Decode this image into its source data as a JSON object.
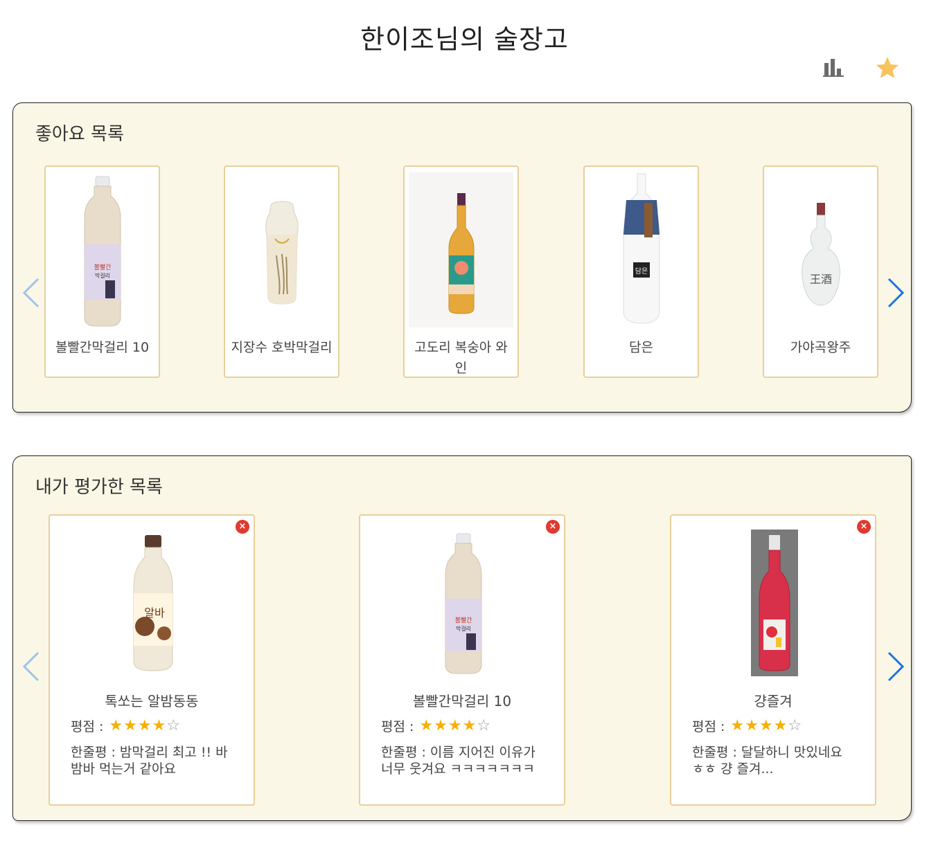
{
  "header": {
    "title": "한이조님의 술장고",
    "stats_icon": "bar-chart-icon",
    "favorite_icon": "star-icon",
    "accent": "#f7c35c"
  },
  "likes": {
    "title": "좋아요 목록",
    "items": [
      {
        "name": "볼빨간막걸리 10"
      },
      {
        "name": "지장수 호박막걸리"
      },
      {
        "name": "고도리 복숭아 와인"
      },
      {
        "name": "담은"
      },
      {
        "name": "가야곡왕주"
      }
    ]
  },
  "rated": {
    "title": "내가 평가한 목록",
    "rating_label": "평점 :",
    "items": [
      {
        "name": "톡쏘는 알밤동동",
        "rating": 4,
        "review": "한줄평 : 밤막걸리 최고 !! 바밤바 먹는거 같아요"
      },
      {
        "name": "볼빨간막걸리 10",
        "rating": 4,
        "review": "한줄평 : 이름 지어진 이유가 너무 웃겨요 ㅋㅋㅋㅋㅋㅋㅋ"
      },
      {
        "name": "걍즐겨",
        "rating": 4,
        "review": "한줄평 : 달달하니 맛있네요 ㅎㅎ 걍 즐겨..."
      }
    ]
  },
  "colors": {
    "panel_bg": "#fbf7e6",
    "card_border": "#e8cf9c",
    "arrow_left": "#9fc3e8",
    "arrow_right": "#1a73e8",
    "delete": "#e0392f"
  }
}
